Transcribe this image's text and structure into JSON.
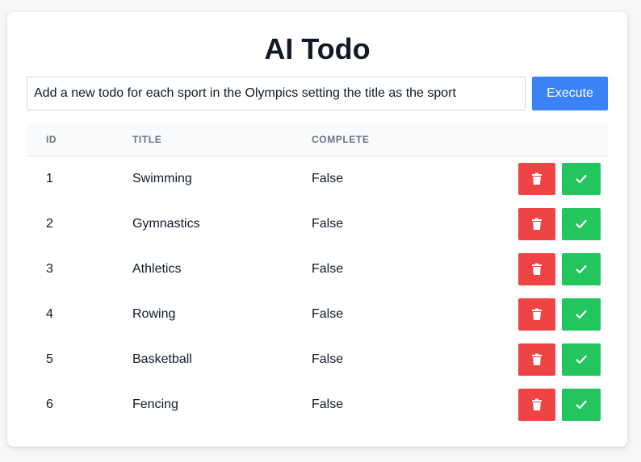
{
  "app": {
    "title": "AI Todo",
    "accent_color": "#3b82f6",
    "delete_color": "#ef4444",
    "complete_color": "#22c55e"
  },
  "command": {
    "value": "Add a new todo for each sport in the Olympics setting the title as the sport",
    "execute_label": "Execute"
  },
  "table": {
    "headers": {
      "id": "ID",
      "title": "TITLE",
      "complete": "COMPLETE"
    },
    "rows": [
      {
        "id": "1",
        "title": "Swimming",
        "complete": "False"
      },
      {
        "id": "2",
        "title": "Gymnastics",
        "complete": "False"
      },
      {
        "id": "3",
        "title": "Athletics",
        "complete": "False"
      },
      {
        "id": "4",
        "title": "Rowing",
        "complete": "False"
      },
      {
        "id": "5",
        "title": "Basketball",
        "complete": "False"
      },
      {
        "id": "6",
        "title": "Fencing",
        "complete": "False"
      }
    ],
    "row_actions": {
      "delete_icon": "trash-icon",
      "complete_icon": "check-icon"
    }
  }
}
